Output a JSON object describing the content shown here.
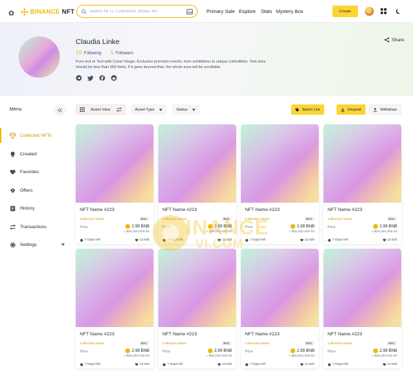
{
  "brand": {
    "name_accent": "BINANCE",
    "name_rest": "NFT",
    "color": "#f0b90b"
  },
  "search": {
    "placeholder": "Search NFTs, Collections, Boxes, etc."
  },
  "nav": {
    "links": [
      "Primary Sale",
      "Explore",
      "Stats",
      "Mystery Box"
    ],
    "create_label": "Create"
  },
  "profile": {
    "name": "Claudia Linke",
    "following_count": "16",
    "following_label": "Following",
    "followers_count": "5",
    "followers_label": "Followers",
    "bio": "Pure text or Text with Cover Image. Exclusive premium events, from exhibitions to unique collectibles. Text area should be less than 500 fonts. If it goes beyond that, the whole area will be scrollable.",
    "socials": [
      "telegram-icon",
      "twitter-icon",
      "facebook-icon",
      "reddit-icon"
    ],
    "share_label": "Share"
  },
  "sidebar": {
    "title": "Menu",
    "items": [
      {
        "label": "Collected NFTs",
        "icon": "diamond-icon",
        "active": true
      },
      {
        "label": "Created",
        "icon": "bulb-icon"
      },
      {
        "label": "Favorites",
        "icon": "heart-icon"
      },
      {
        "label": "Offers",
        "icon": "offers-icon"
      },
      {
        "label": "History",
        "icon": "history-icon"
      },
      {
        "label": "Transactions",
        "icon": "transfer-icon"
      },
      {
        "label": "Settings",
        "icon": "gear-icon",
        "caret": true
      }
    ]
  },
  "toolbar": {
    "asset_view": "Asset View",
    "asset_type": "Asset Type",
    "status": "Status",
    "batch_list": "Batch List",
    "deposit": "Deposit",
    "withdraw": "Withdraw"
  },
  "cards": [
    {
      "name": "NFT Name #223",
      "collection": "Collection Name",
      "chain": "BSC",
      "price_label": "Price",
      "price": "2.99 BNB",
      "usd": "≈ $65,000,000.00",
      "days": "7 Days left",
      "likes": "12.62k"
    },
    {
      "name": "NFT Name #223",
      "collection": "Collection Name",
      "chain": "BSC",
      "price_label": "Price",
      "price": "2.99 BNB",
      "usd": "≈ $65,000,000.00",
      "days": "7 Days left",
      "likes": "12.62k"
    },
    {
      "name": "NFT Name #223",
      "collection": "Collection Name",
      "chain": "BSC",
      "price_label": "Price",
      "price": "2.99 BNB",
      "usd": "≈ $65,000,000.00",
      "days": "7 Days left",
      "likes": "12.62k"
    },
    {
      "name": "NFT Name #223",
      "collection": "Collection Name",
      "chain": "BSC",
      "price_label": "Price",
      "price": "2.99 BNB",
      "usd": "≈ $65,000,000.00",
      "days": "7 Days left",
      "likes": "12.62k"
    },
    {
      "name": "NFT Name #223",
      "collection": "Collection Name",
      "chain": "BSC",
      "price_label": "Price",
      "price": "2.99 BNB",
      "usd": "≈ $65,000,000.00",
      "days": "7 Days left",
      "likes": "12.62k"
    },
    {
      "name": "NFT Name #223",
      "collection": "Collection Name",
      "chain": "BSC",
      "price_label": "Price",
      "price": "2.99 BNB",
      "usd": "≈ $65,000,000.00",
      "days": "7 Days left",
      "likes": "12.62k"
    },
    {
      "name": "NFT Name #223",
      "collection": "Collection Name",
      "chain": "BSC",
      "price_label": "Price",
      "price": "2.99 BNB",
      "usd": "≈ $65,000,000.00",
      "days": "7 Days left",
      "likes": "12.62k"
    },
    {
      "name": "NFT Name #223",
      "collection": "Collection Name",
      "chain": "BSC",
      "price_label": "Price",
      "price": "2.99 BNB",
      "usd": "≈ $65,000,000.00",
      "days": "7 Days left",
      "likes": "12.62k"
    }
  ],
  "watermark": {
    "line1": "INANCE",
    "line2": "VI.COM"
  }
}
